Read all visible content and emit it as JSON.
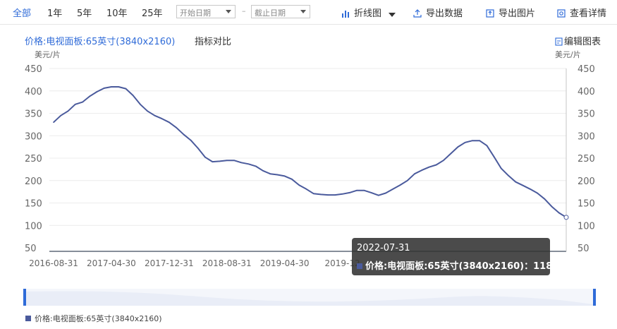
{
  "toolbar": {
    "ranges": [
      "全部",
      "1年",
      "5年",
      "10年",
      "25年"
    ],
    "start_date_placeholder": "开始日期",
    "end_date_placeholder": "截止日期",
    "chart_type_label": "折线图",
    "export_data_label": "导出数据",
    "export_image_label": "导出图片",
    "details_label": "查看详情"
  },
  "header": {
    "series_title": "价格:电视面板:65英寸(3840x2160)",
    "compare_label": "指标对比",
    "edit_label": "编辑图表",
    "unit_left": "美元/片",
    "unit_right": "美元/片"
  },
  "tooltip": {
    "date": "2022-07-31",
    "series": "价格:电视面板:65英寸(3840x2160)",
    "value": "118"
  },
  "legend": {
    "label": "价格:电视面板:65英寸(3840x2160)"
  },
  "colors": {
    "accent": "#2f6bd8",
    "series": "#4a5a9c",
    "grid": "#ececec",
    "tooltip_bg": "#323232"
  },
  "chart_data": {
    "type": "line",
    "title": "价格:电视面板:65英寸(3840x2160)",
    "ylabel": "美元/片",
    "ylim": [
      50,
      450
    ],
    "yticks": [
      450,
      400,
      350,
      300,
      250,
      200,
      150,
      100,
      50
    ],
    "xticks": [
      "2016-08-31",
      "2017-04-30",
      "2017-12-31",
      "2018-08-31",
      "2019-04-30",
      "2019-12"
    ],
    "x": [
      "2016-08-31",
      "2016-09-30",
      "2016-10-31",
      "2016-11-30",
      "2016-12-31",
      "2017-01-31",
      "2017-02-28",
      "2017-03-31",
      "2017-04-30",
      "2017-05-31",
      "2017-06-30",
      "2017-07-31",
      "2017-08-31",
      "2017-09-30",
      "2017-10-31",
      "2017-11-30",
      "2017-12-31",
      "2018-01-31",
      "2018-02-28",
      "2018-03-31",
      "2018-04-30",
      "2018-05-31",
      "2018-06-30",
      "2018-07-31",
      "2018-08-31",
      "2018-09-30",
      "2018-10-31",
      "2018-11-30",
      "2018-12-31",
      "2019-01-31",
      "2019-02-28",
      "2019-03-31",
      "2019-04-30",
      "2019-05-31",
      "2019-06-30",
      "2019-07-31",
      "2019-08-31",
      "2019-09-30",
      "2019-10-31",
      "2019-11-30",
      "2019-12-31",
      "2020-01-31",
      "2020-02-29",
      "2020-03-31",
      "2020-04-30",
      "2020-05-31",
      "2020-06-30",
      "2020-07-31",
      "2020-08-31",
      "2020-09-30",
      "2020-10-31",
      "2020-11-30",
      "2020-12-31",
      "2021-01-31",
      "2021-02-28",
      "2021-03-31",
      "2021-04-30",
      "2021-05-31",
      "2021-06-30",
      "2021-07-31",
      "2021-08-31",
      "2021-09-30",
      "2021-10-31",
      "2021-11-30",
      "2021-12-31",
      "2022-01-31",
      "2022-02-28",
      "2022-03-31",
      "2022-04-30",
      "2022-05-31",
      "2022-06-30",
      "2022-07-31"
    ],
    "series": [
      {
        "name": "价格:电视面板:65英寸(3840x2160)",
        "values": [
          330,
          345,
          355,
          370,
          375,
          388,
          398,
          406,
          409,
          409,
          405,
          390,
          370,
          355,
          345,
          338,
          330,
          318,
          303,
          290,
          272,
          252,
          242,
          243,
          245,
          245,
          240,
          237,
          232,
          222,
          215,
          213,
          210,
          203,
          190,
          181,
          171,
          169,
          168,
          168,
          170,
          173,
          178,
          178,
          173,
          167,
          172,
          181,
          190,
          200,
          215,
          223,
          230,
          235,
          245,
          260,
          275,
          285,
          289,
          289,
          278,
          253,
          227,
          211,
          197,
          189,
          181,
          172,
          159,
          142,
          128,
          118
        ]
      }
    ]
  }
}
